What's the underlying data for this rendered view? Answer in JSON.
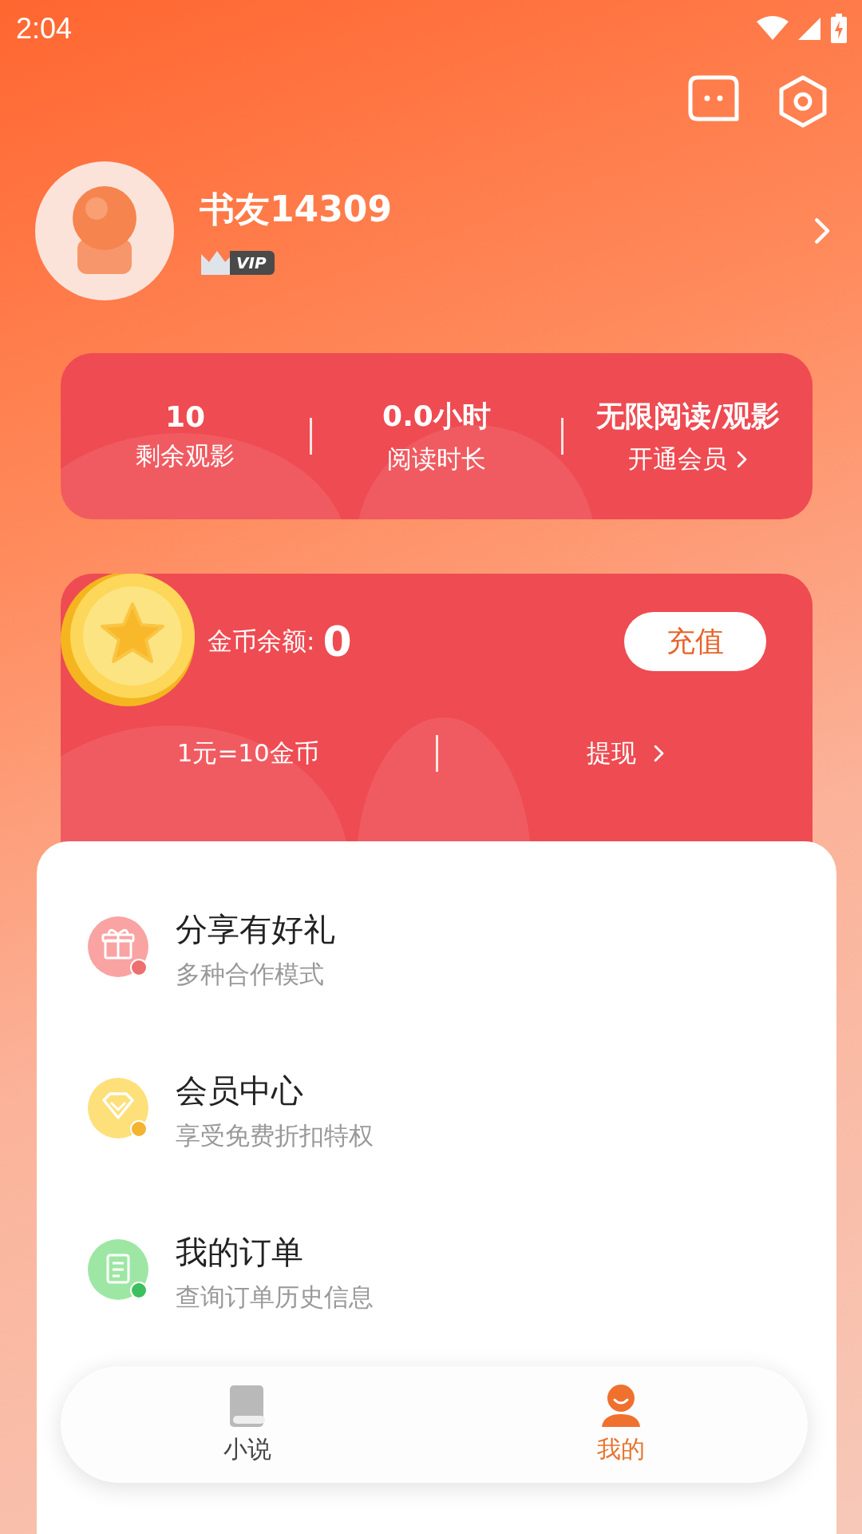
{
  "status_bar": {
    "time": "2:04"
  },
  "profile": {
    "name": "书友14309",
    "badge": "VIP"
  },
  "stats": [
    {
      "value": "10",
      "label": "剩余观影",
      "link": false
    },
    {
      "value": "0.0小时",
      "label": "阅读时长",
      "link": false
    },
    {
      "value": "无限阅读/观影",
      "label": "开通会员",
      "link": true
    }
  ],
  "wallet": {
    "balance_label": "金币余额:",
    "balance": "0",
    "recharge_button": "充值",
    "rate": "1元=10金币",
    "withdraw": "提现"
  },
  "menu": [
    {
      "title": "分享有好礼",
      "subtitle": "多种合作模式",
      "kind": "gift"
    },
    {
      "title": "会员中心",
      "subtitle": "享受免费折扣特权",
      "kind": "diamond"
    },
    {
      "title": "我的订单",
      "subtitle": "查询订单历史信息",
      "kind": "order"
    }
  ],
  "tabs": [
    {
      "label": "小说",
      "selected": false,
      "kind": "book"
    },
    {
      "label": "我的",
      "selected": true,
      "kind": "person"
    }
  ]
}
